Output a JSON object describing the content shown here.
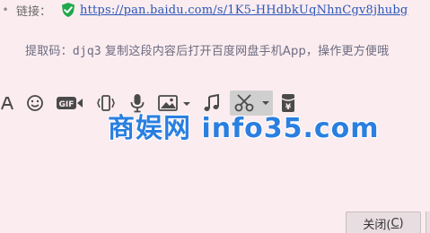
{
  "share": {
    "bullet": "•",
    "link_label": "链接：",
    "url": "https://pan.baidu.com/s/1K5-HHdbkUqNhnCgv8jhubg",
    "code_label": "提取码：",
    "code": "djq3",
    "instruction": "复制这段内容后打开百度网盘手机App，操作更方便哦"
  },
  "toolbar": {
    "items": [
      {
        "name": "font-icon",
        "glyph": "A"
      },
      {
        "name": "emoji-icon"
      },
      {
        "name": "gif-icon",
        "label": "GIF"
      },
      {
        "name": "shake-icon"
      },
      {
        "name": "voice-icon"
      },
      {
        "name": "image-icon"
      },
      {
        "name": "music-icon",
        "glyph": "♫"
      },
      {
        "name": "screenshot-icon"
      },
      {
        "name": "red-packet-icon",
        "glyph": "¥"
      }
    ]
  },
  "watermark": "商娱网 info35.com",
  "footer": {
    "close_label": "关闭(",
    "close_hotkey": "C",
    "close_suffix": ")"
  },
  "colors": {
    "background": "#fbecef",
    "link": "#2a55b8",
    "shield": "#1fa84a",
    "watermark": "#2a7fe0",
    "active_tool_bg": "#cfcfcf"
  }
}
